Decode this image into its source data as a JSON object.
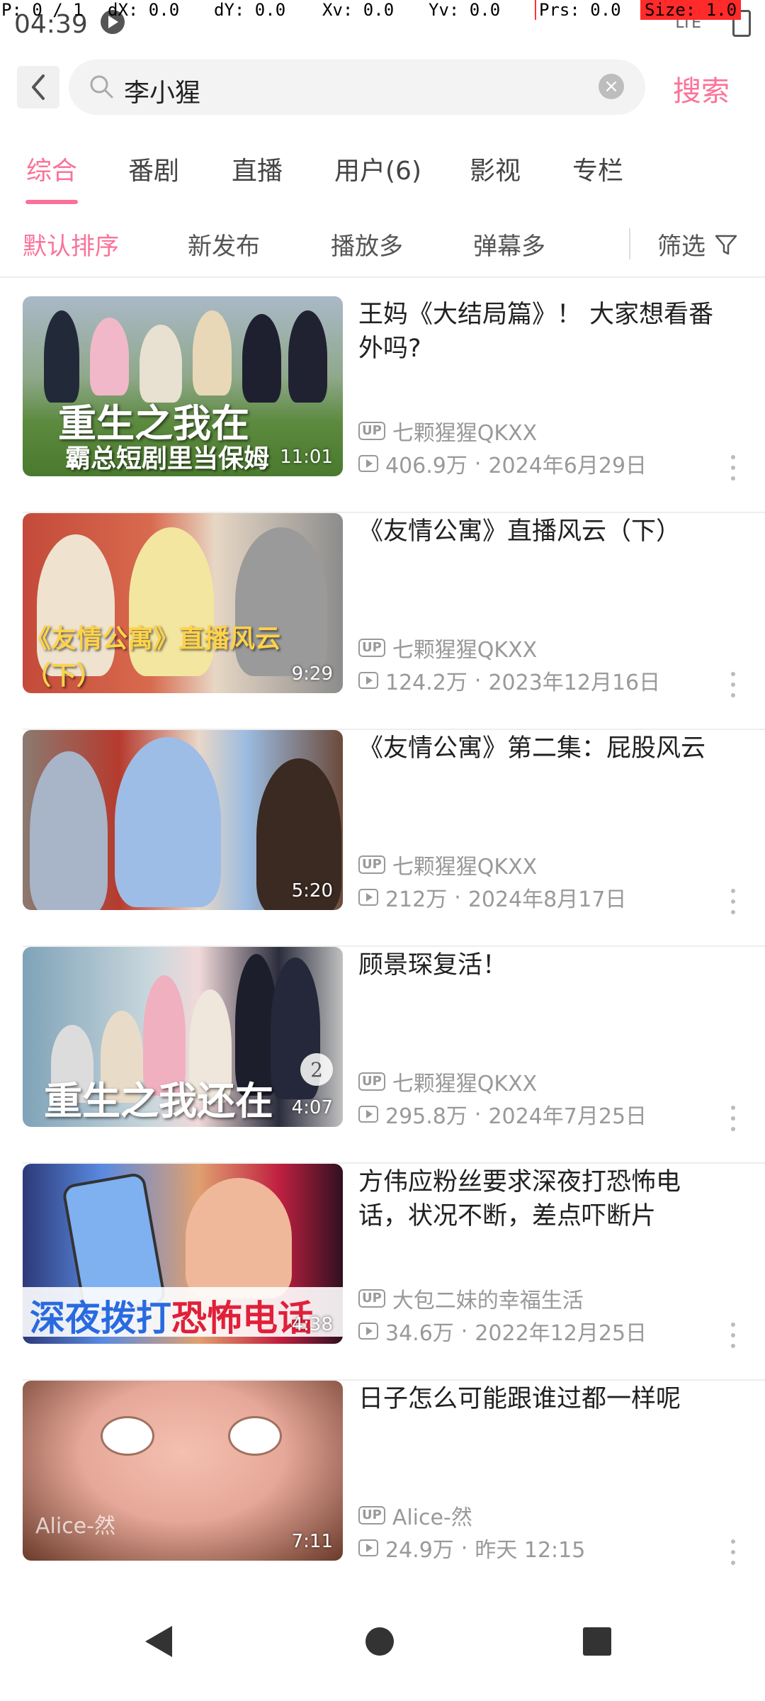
{
  "debug": {
    "p": "P: 0 / 1",
    "dx": "dX: 0.0",
    "dy": "dY: 0.0",
    "xv": "Xv: 0.0",
    "yv": "Yv: 0.0",
    "prs": "Prs: 0.0",
    "size": "Size: 1.0"
  },
  "status": {
    "time": "04:39",
    "signal": "LTE"
  },
  "search": {
    "query": "李小猩",
    "submit_label": "搜索"
  },
  "tabs": [
    {
      "label": "综合",
      "active": true
    },
    {
      "label": "番剧"
    },
    {
      "label": "直播"
    },
    {
      "label": "用户(6)"
    },
    {
      "label": "影视"
    },
    {
      "label": "专栏"
    }
  ],
  "sort": {
    "options": [
      "默认排序",
      "新发布",
      "播放多",
      "弹幕多"
    ],
    "active_index": 0,
    "filter_label": "筛选"
  },
  "videos": [
    {
      "title": "王妈《大结局篇》！ 大家想看番外吗?",
      "author": "七颗猩猩QKXX",
      "views": "406.9万",
      "date": "2024年6月29日",
      "duration": "11:01",
      "overlay": "重生之我在",
      "overlay_sub": "霸总短剧里当保姆"
    },
    {
      "title": "《友情公寓》直播风云（下）",
      "author": "七颗猩猩QKXX",
      "views": "124.2万",
      "date": "2023年12月16日",
      "duration": "9:29",
      "overlay_sub": "《友情公寓》直播风云（下）"
    },
    {
      "title": "《友情公寓》第二集：屁股风云",
      "author": "七颗猩猩QKXX",
      "views": "212万",
      "date": "2024年8月17日",
      "duration": "5:20"
    },
    {
      "title": "顾景琛复活！",
      "author": "七颗猩猩QKXX",
      "views": "295.8万",
      "date": "2024年7月25日",
      "duration": "4:07",
      "overlay": "重生之我还在",
      "badge": "2"
    },
    {
      "title": "方伟应粉丝要求深夜打恐怖电话，状况不断，差点吓断片",
      "author": "大包二妹的幸福生活",
      "views": "34.6万",
      "date": "2022年12月25日",
      "duration": "4:38",
      "banner_a": "深夜拨打",
      "banner_b": "恐怖电话"
    },
    {
      "title": "日子怎么可能跟谁过都一样呢",
      "author": "Alice-然",
      "views": "24.9万",
      "date": "昨天 12:15",
      "duration": "7:11",
      "watermark": "Alice-然"
    }
  ],
  "up_tag": "UP",
  "colors": {
    "accent": "#fb7299",
    "meta": "#999999"
  }
}
